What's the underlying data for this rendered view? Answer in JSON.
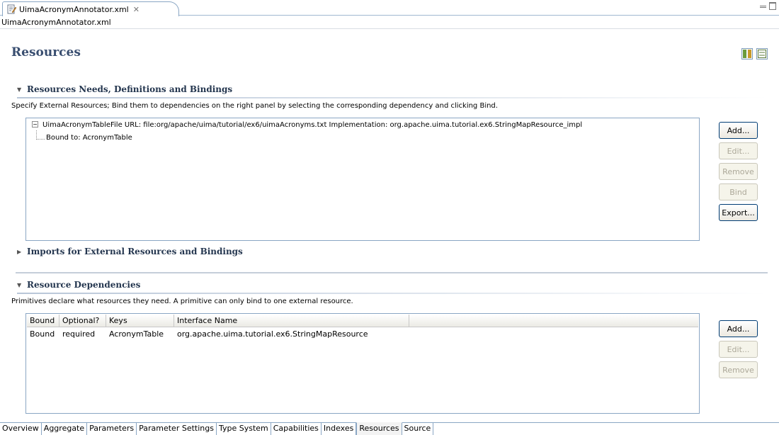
{
  "editor_tab": {
    "title": "UimaAcronymAnnotator.xml",
    "close_icon": "close-icon"
  },
  "path_bar": "UimaAcronymAnnotator.xml",
  "page_title": "Resources",
  "section1": {
    "title": "Resources Needs, Definitions and Bindings",
    "description": "Specify External Resources; Bind them to dependencies on the right panel by selecting the corresponding dependency and clicking Bind.",
    "tree_root": "UimaAcronymTableFile  URL: file:org/apache/uima/tutorial/ex6/uimaAcronyms.txt  Implementation: org.apache.uima.tutorial.ex6.StringMapResource_impl",
    "tree_child": "Bound to: AcronymTable",
    "buttons": {
      "add": "Add...",
      "edit": "Edit...",
      "remove": "Remove",
      "bind": "Bind",
      "export": "Export..."
    }
  },
  "section_imports": {
    "title": "Imports for External Resources and Bindings"
  },
  "section2": {
    "title": "Resource Dependencies",
    "description": "Primitives declare what resources they need. A primitive can only bind to one external resource.",
    "columns": {
      "bound": "Bound",
      "optional": "Optional?",
      "keys": "Keys",
      "interface": "Interface Name"
    },
    "row": {
      "bound": "Bound",
      "optional": "required",
      "keys": "AcronymTable",
      "interface": "org.apache.uima.tutorial.ex6.StringMapResource"
    },
    "buttons": {
      "add": "Add...",
      "edit": "Edit...",
      "remove": "Remove"
    }
  },
  "bottom_tabs": [
    "Overview",
    "Aggregate",
    "Parameters",
    "Parameter Settings",
    "Type System",
    "Capabilities",
    "Indexes",
    "Resources",
    "Source"
  ],
  "selected_tab": "Resources"
}
